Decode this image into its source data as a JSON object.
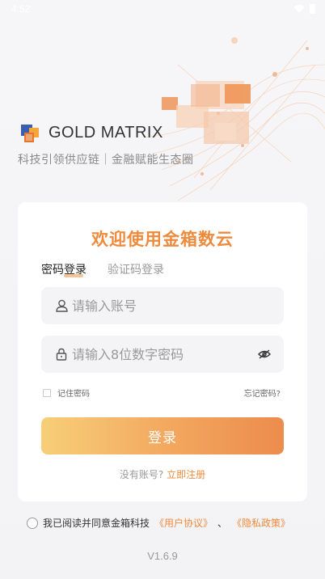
{
  "status_bar": {
    "time": "4:52"
  },
  "brand": {
    "name": "GOLD MATRIX",
    "slogan": "科技引领供应链｜金融赋能生态圈"
  },
  "login": {
    "welcome": "欢迎使用金箱数云",
    "tabs": [
      {
        "label": "密码登录",
        "active": true
      },
      {
        "label": "验证码登录",
        "active": false
      }
    ],
    "account_placeholder": "请输入账号",
    "password_placeholder": "请输入8位数字密码",
    "remember_label": "记住密码",
    "forgot_label": "忘记密码?",
    "submit_label": "登录",
    "no_account_text": "没有账号?",
    "register_link": "立即注册"
  },
  "agreement": {
    "prefix": "我已阅读并同意金箱科技",
    "user_agreement": "《用户协议》",
    "separator": "、",
    "privacy_policy": "《隐私政策》"
  },
  "version": "V1.6.9",
  "colors": {
    "accent": "#ee8a3c",
    "button_start": "#f7cf78",
    "button_end": "#ec8c4d"
  },
  "icons": [
    "wifi-icon",
    "battery-icon",
    "user-icon",
    "lock-icon",
    "eye-off-icon"
  ]
}
